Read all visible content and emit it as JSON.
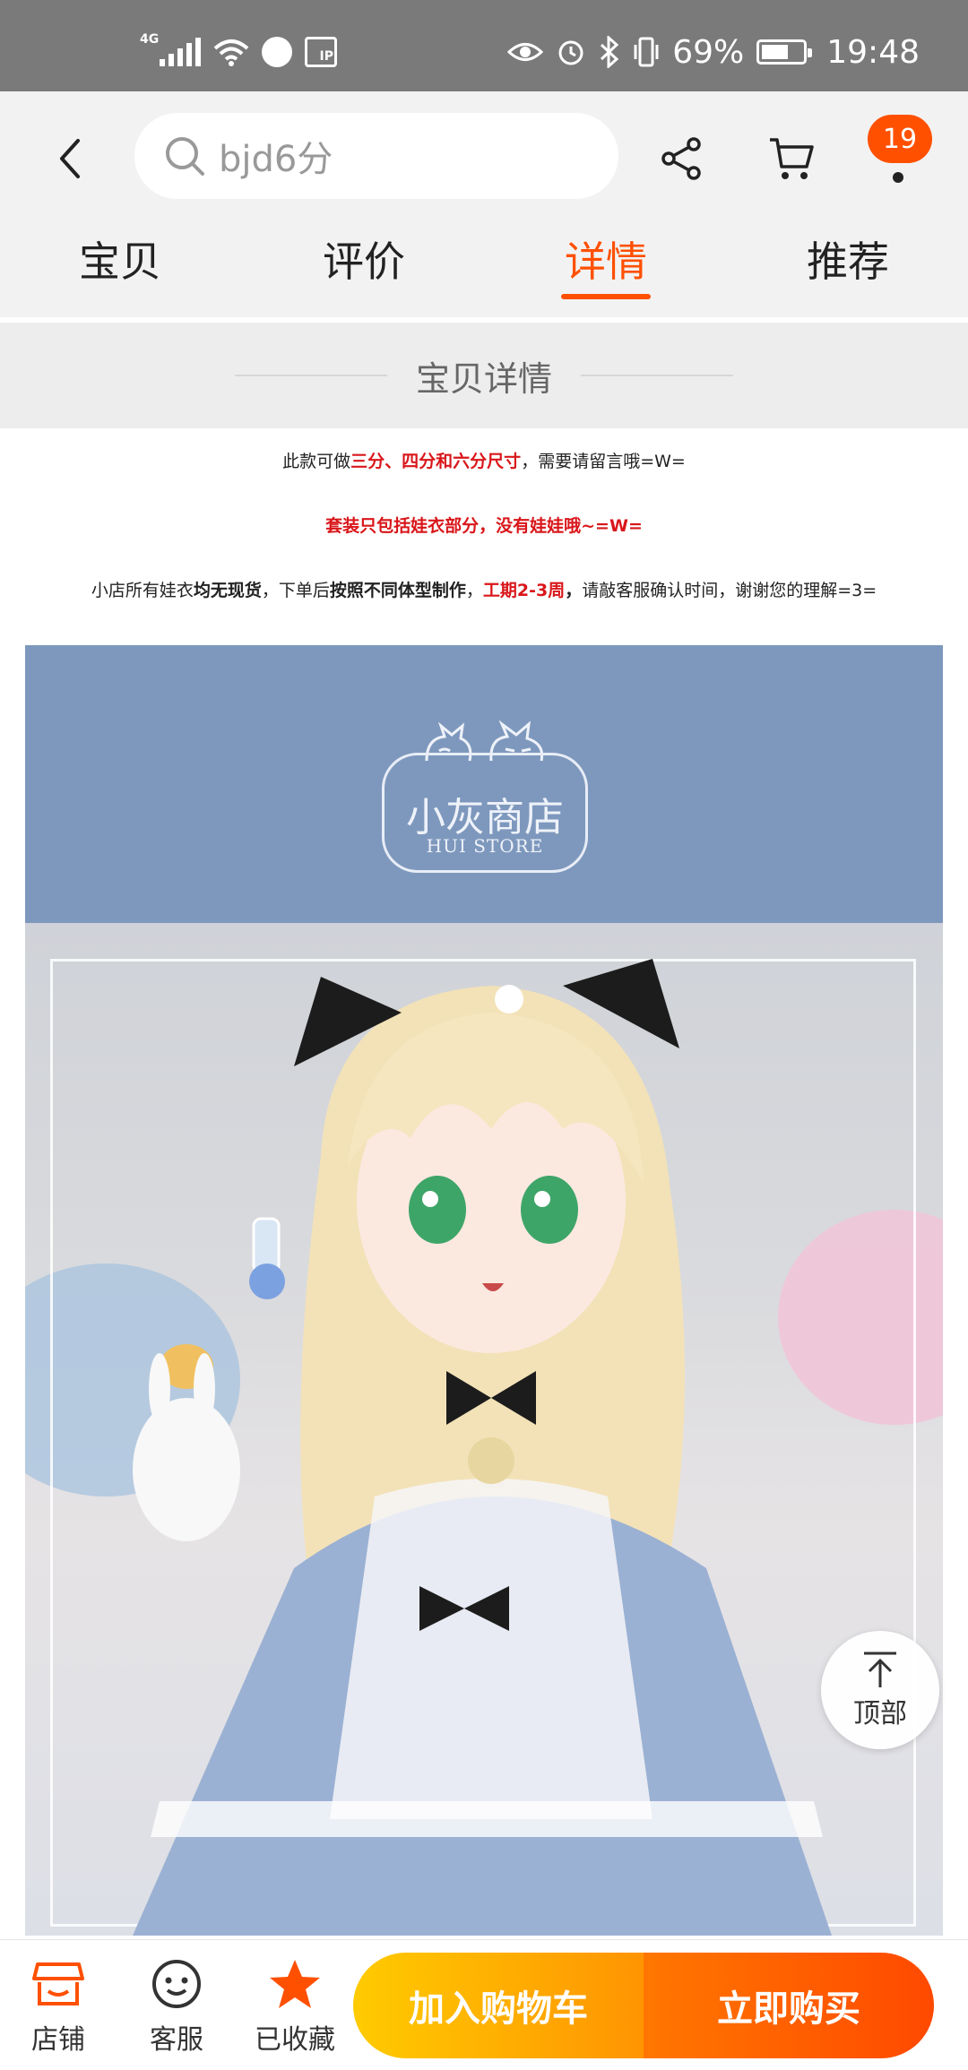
{
  "status_bar": {
    "network": "4G",
    "battery": "69%",
    "battery_level": 0.69,
    "time": "19:48"
  },
  "header": {
    "search_text": "bjd6分",
    "cart_badge": "19",
    "icons": [
      "back-icon",
      "search-icon",
      "share-icon",
      "cart-icon"
    ]
  },
  "tabs": [
    {
      "label": "宝贝",
      "active": false
    },
    {
      "label": "评价",
      "active": false
    },
    {
      "label": "详情",
      "active": true
    },
    {
      "label": "推荐",
      "active": false
    }
  ],
  "section": {
    "title": "宝贝详情"
  },
  "notes": {
    "line1": {
      "pre": "此款可做",
      "red": "三分、四分和六分尺寸",
      "post": "，需要请留言哦=W="
    },
    "line2": {
      "red": "套装只包括娃衣部分，没有娃娃哦~=W="
    },
    "line3": {
      "a": "小店所有娃衣",
      "b": "均无现货",
      "c": "，下单后",
      "d": "按照不同体型制作",
      "e": "，",
      "f": "工期2-3周",
      "g": "，",
      "h": "请敲客服确认时间，谢谢您的理解=3="
    }
  },
  "banner": {
    "logo_cn": "小灰商店",
    "logo_en": "HUI STORE",
    "color": "#7e98bd"
  },
  "top_button": {
    "label": "顶部"
  },
  "bottom_bar": {
    "shop": "店铺",
    "service": "客服",
    "favorited": "已收藏",
    "add_to_cart": "加入购物车",
    "buy_now": "立即购买"
  },
  "colors": {
    "accent": "#ff5000",
    "cart_gradient": [
      "#ffcb00",
      "#ff9402"
    ],
    "buy_gradient": [
      "#ff7700",
      "#ff4900"
    ],
    "note_red": "#d9161a"
  }
}
